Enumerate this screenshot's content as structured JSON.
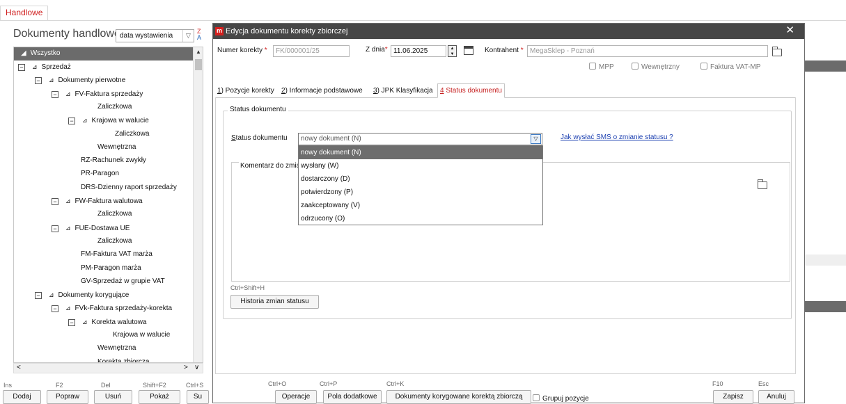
{
  "top_tab": {
    "label": "Handlowe"
  },
  "left_panel": {
    "title": "Dokumenty handlowe",
    "combo_value": "data wystawienia",
    "tree_header": "Wszystko",
    "tree": [
      {
        "label": "Sprzedaż",
        "box": "−",
        "tri": "⊿"
      },
      {
        "label": "Dokumenty pierwotne",
        "box": "−",
        "tri": "⊿"
      },
      {
        "label": "FV-Faktura sprzedaży",
        "box": "−",
        "tri": "⊿"
      },
      {
        "label": "Zaliczkowa"
      },
      {
        "label": "Krajowa w walucie",
        "box": "−",
        "tri": "⊿"
      },
      {
        "label": "Zaliczkowa"
      },
      {
        "label": "Wewnętrzna"
      },
      {
        "label": "RZ-Rachunek zwykły"
      },
      {
        "label": "PR-Paragon"
      },
      {
        "label": "DRS-Dzienny raport sprzedaży"
      },
      {
        "label": "FW-Faktura walutowa",
        "box": "−",
        "tri": "⊿"
      },
      {
        "label": "Zaliczkowa"
      },
      {
        "label": "FUE-Dostawa UE",
        "box": "−",
        "tri": "⊿"
      },
      {
        "label": "Zaliczkowa"
      },
      {
        "label": "FM-Faktura VAT marża"
      },
      {
        "label": "PM-Paragon marża"
      },
      {
        "label": "GV-Sprzedaż w grupie VAT"
      },
      {
        "label": "Dokumenty korygujące",
        "box": "−",
        "tri": "⊿"
      },
      {
        "label": "FVk-Faktura sprzedaży-korekta",
        "box": "−",
        "tri": "⊿"
      },
      {
        "label": "Korekta walutowa",
        "box": "−",
        "tri": "⊿"
      },
      {
        "label": "Krajowa w walucie"
      },
      {
        "label": "Wewnętrzna"
      },
      {
        "label": "Korekta zbiorcza"
      }
    ],
    "shortcuts": [
      "Ins",
      "F2",
      "Del",
      "Shift+F2",
      "Ctrl+S"
    ],
    "buttons": [
      "Dodaj",
      "Popraw",
      "Usuń",
      "Pokaż",
      "Su"
    ]
  },
  "dialog": {
    "title": "Edycja dokumentu korekty zbiorczej",
    "close": "✕",
    "numer_label": "Numer korekty",
    "numer_value": "FK/000001/25",
    "zdnia_label": "Z dnia",
    "zdnia_value": "11.06.2025",
    "kontrahent_label": "Kontrahent",
    "kontrahent_value": "MegaSklep - Poznań",
    "checkboxes": [
      "MPP",
      "Wewnętrzny",
      "Faktura VAT-MP"
    ],
    "tabs": [
      {
        "key": "1",
        "label": ") Pozycje korekty"
      },
      {
        "key": "2",
        "label": ") Informacje podstawowe"
      },
      {
        "key": "3",
        "label": ") JPK Klasyfikacja"
      },
      {
        "key": "4",
        "label": " Status dokumentu"
      }
    ],
    "group_title": "Status dokumentu",
    "status_label": "Status dokumentu",
    "status_value": "nowy dokument (N)",
    "status_options": [
      "nowy dokument (N)",
      "wysłany (W)",
      "dostarczony (D)",
      "potwierdzony (P)",
      "zaakceptowany (V)",
      "odrzucony (O)"
    ],
    "sms_link": "Jak wysłać SMS o zmianie statusu ?",
    "comment_label": "Komentarz do zmia",
    "history_shortcut": "Ctrl+Shift+H",
    "history_button": "Historia zmian statusu",
    "footer": {
      "shortcuts": [
        "Ctrl+O",
        "Ctrl+P",
        "Ctrl+K",
        "F10",
        "Esc"
      ],
      "operacje": "Operacje",
      "pola": "Pola dodatkowe",
      "dokumenty": "Dokumenty korygowane korektą zbiorczą",
      "grupuj": "Grupuj pozycje",
      "zapisz": "Zapisz",
      "anuluj": "Anuluj"
    }
  },
  "colors": {
    "accent_red": "#d01f1f",
    "title_bar": "#474747",
    "link_blue": "#1b3fb0"
  }
}
